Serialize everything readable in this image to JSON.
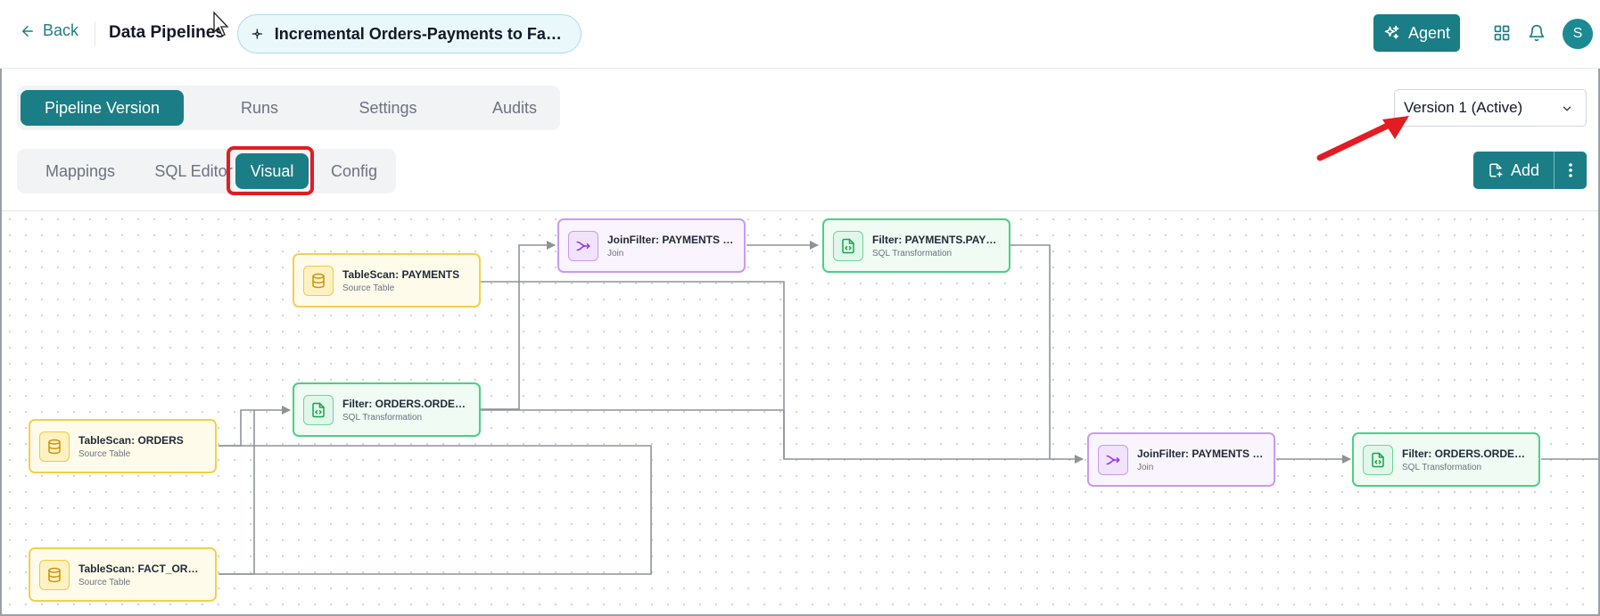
{
  "header": {
    "back_label": "Back",
    "breadcrumb": "Data Pipelines",
    "pipeline_title": "Incremental Orders-Payments to Fact O…",
    "agent_label": "Agent",
    "avatar_initial": "S"
  },
  "tabs": [
    {
      "label": "Pipeline Version",
      "active": true
    },
    {
      "label": "Runs",
      "active": false
    },
    {
      "label": "Settings",
      "active": false
    },
    {
      "label": "Audits",
      "active": false
    }
  ],
  "subtabs": [
    {
      "label": "Mappings",
      "active": false
    },
    {
      "label": "SQL Editor",
      "active": false
    },
    {
      "label": "Visual",
      "active": true
    },
    {
      "label": "Config",
      "active": false
    }
  ],
  "version_select": {
    "value": "Version 1 (Active)"
  },
  "add_button": {
    "label": "Add"
  },
  "colors": {
    "accent": "#1b7d86",
    "annotation": "#e31b23",
    "source": "#f3cf4d",
    "sql": "#4ccf86",
    "join": "#c79af2"
  },
  "graph": {
    "nodes": [
      {
        "id": "n1",
        "kind": "source",
        "icon": "database-icon",
        "title": "TableScan: PAYMENTS",
        "subtitle": "Source Table"
      },
      {
        "id": "n2",
        "kind": "source",
        "icon": "database-icon",
        "title": "TableScan: ORDERS",
        "subtitle": "Source Table"
      },
      {
        "id": "n3",
        "kind": "source",
        "icon": "database-icon",
        "title": "TableScan: FACT_ORD…",
        "subtitle": "Source Table"
      },
      {
        "id": "n4",
        "kind": "sql",
        "icon": "code-file-icon",
        "title": "Filter: ORDERS.ORDER…",
        "subtitle": "SQL Transformation"
      },
      {
        "id": "n5",
        "kind": "join",
        "icon": "merge-icon",
        "title": "JoinFilter: PAYMENTS […",
        "subtitle": "Join"
      },
      {
        "id": "n6",
        "kind": "sql",
        "icon": "code-file-icon",
        "title": "Filter: PAYMENTS.PAY…",
        "subtitle": "SQL Transformation"
      },
      {
        "id": "n7",
        "kind": "join",
        "icon": "merge-icon",
        "title": "JoinFilter: PAYMENTS […",
        "subtitle": "Join"
      },
      {
        "id": "n8",
        "kind": "sql",
        "icon": "code-file-icon",
        "title": "Filter: ORDERS.ORDER…",
        "subtitle": "SQL Transformation"
      }
    ]
  }
}
